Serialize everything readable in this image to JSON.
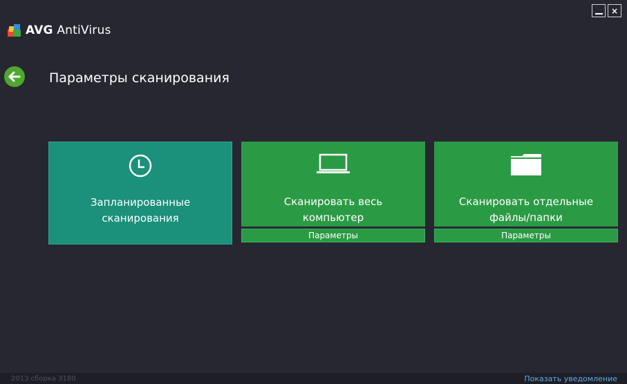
{
  "window": {
    "controls": {
      "minimize_icon": "minimize-icon",
      "close_icon": "close-icon",
      "close_glyph": "×"
    }
  },
  "brand": {
    "logo_icon": "avg-logo-icon",
    "name_bold": "AVG",
    "name_rest": "AntiVirus"
  },
  "header": {
    "back_icon": "back-arrow-icon",
    "title": "Параметры сканирования"
  },
  "tiles": [
    {
      "icon": "clock-icon",
      "label": "Запланированные\nсканирования",
      "color": "#1b907a"
    },
    {
      "icon": "laptop-icon",
      "label": "Сканировать весь\nкомпьютер",
      "color": "#2b9a45",
      "sub_label": "Параметры"
    },
    {
      "icon": "folder-icon",
      "label": "Сканировать отдельные\nфайлы/папки",
      "color": "#2b9a45",
      "sub_label": "Параметры"
    }
  ],
  "footer": {
    "build": "2013  сборка 3180",
    "notify_link": "Показать уведомление"
  },
  "colors": {
    "background": "#272731",
    "accent_green": "#4fa72f",
    "tile_teal": "#1b907a",
    "tile_green": "#2b9a45",
    "link_blue": "#5ab0e6"
  }
}
